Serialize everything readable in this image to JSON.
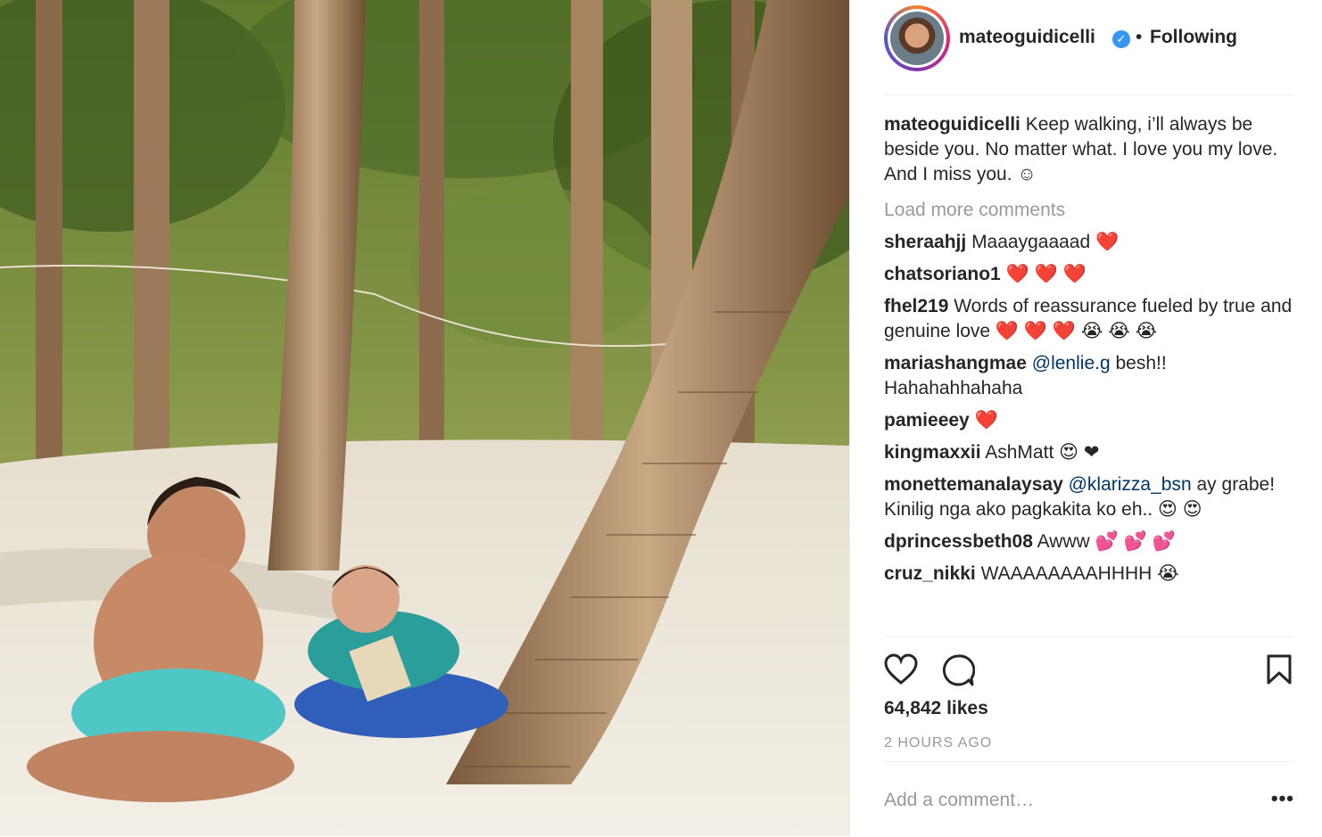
{
  "post": {
    "username": "mateoguidicelli",
    "verified_icon": "verified-badge-icon",
    "separator": "•",
    "follow_label": "Following"
  },
  "caption": {
    "user": "mateoguidicelli",
    "text": "Keep walking, i’ll always be beside you. No matter what. I love you my love. And I miss you. ☺"
  },
  "load_more": "Load more comments",
  "comments": [
    {
      "user": "sheraahjj",
      "text": "Maaaygaaaad ❤️"
    },
    {
      "user": "chatsoriano1",
      "text": "❤️ ❤️ ❤️"
    },
    {
      "user": "fhel219",
      "text": "Words of reassurance fueled by true and genuine love ❤️ ❤️ ❤️ 😭 😭 😭"
    },
    {
      "user": "mariashangmae",
      "mention": "@lenlie.g",
      "text": "besh!! Hahahahhahaha"
    },
    {
      "user": "pamieeey",
      "text": "❤️"
    },
    {
      "user": "kingmaxxii",
      "text": "AshMatt 😍 ❤"
    },
    {
      "user": "monettemanalaysay",
      "mention": "@klarizza_bsn",
      "text": "ay grabe! Kinilig nga ako pagkakita ko eh.. 😍 😍"
    },
    {
      "user": "dprincessbeth08",
      "text": "Awww 💕 💕 💕"
    },
    {
      "user": "cruz_nikki",
      "text": "WAAAAAAAAHHHH 😭"
    }
  ],
  "actions": {
    "like_icon": "heart-outline-icon",
    "comment_icon": "comment-bubble-icon",
    "save_icon": "bookmark-icon"
  },
  "likes": "64,842 likes",
  "timestamp": "2 HOURS AGO",
  "add_comment_placeholder": "Add a comment…",
  "more_label": "•••"
}
